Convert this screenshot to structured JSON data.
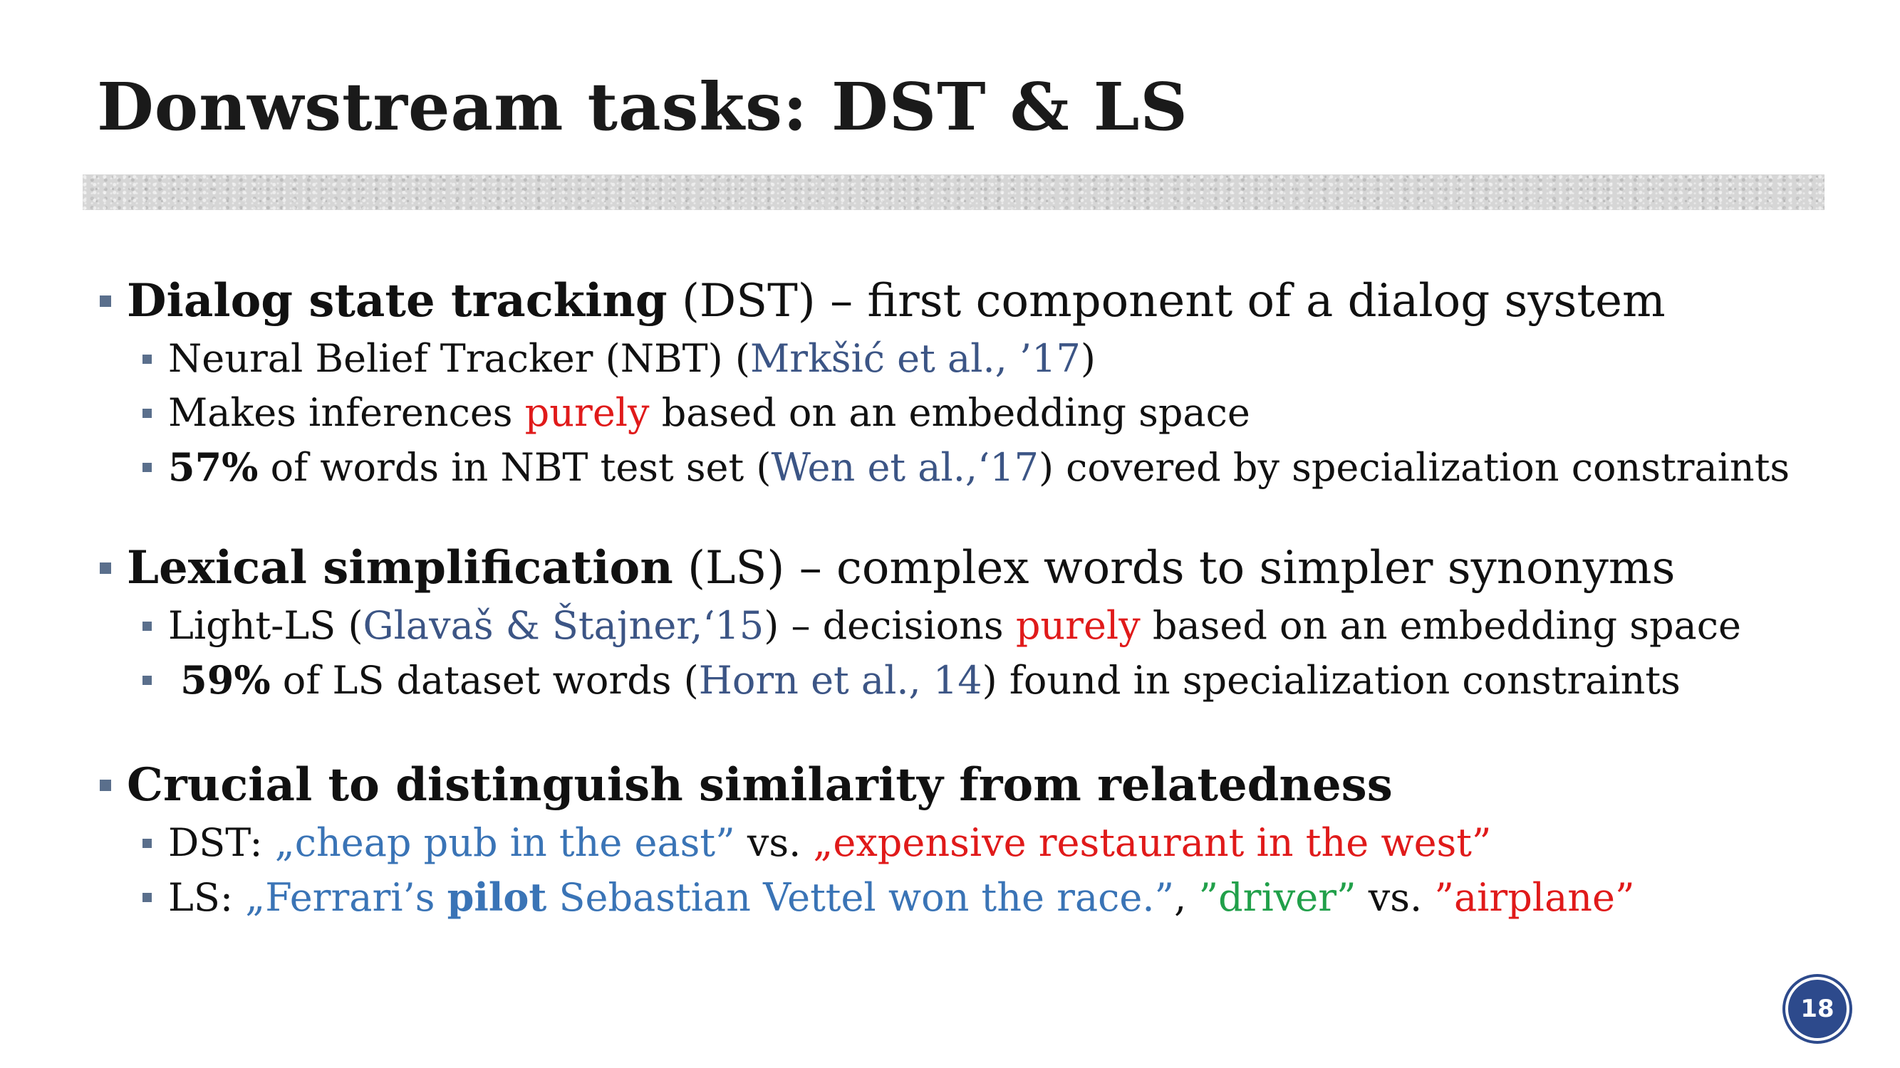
{
  "slide": {
    "title": "Donwstream tasks: DST & LS",
    "page_number": "18"
  },
  "sections": {
    "dst": {
      "heading_bold": "Dialog state tracking",
      "heading_rest": " (DST) – first component of a dialog system",
      "sub1": {
        "pre": "Neural Belief Tracker (NBT) (",
        "cite": "Mrkšić et al., ’17",
        "post": ")"
      },
      "sub2": {
        "pre": "Makes inferences ",
        "highlight": "purely",
        "post": " based on an embedding space"
      },
      "sub3": {
        "bold": "57%",
        "pre": " of words in NBT test set (",
        "cite": "Wen et al.,‘17",
        "post": ") covered by specialization constraints"
      }
    },
    "ls": {
      "heading_bold": "Lexical simplification",
      "heading_rest": " (LS) – complex words to simpler synonyms",
      "sub1": {
        "pre": "Light-LS (",
        "cite": "Glavaš & Štajner,‘15",
        "mid": ") – decisions ",
        "highlight": "purely",
        "post": " based on an embedding space"
      },
      "sub2": {
        "bold": "59%",
        "pre": " of LS dataset words (",
        "cite": "Horn et al., 14",
        "post": ") found in specialization constraints"
      }
    },
    "crucial": {
      "heading_bold": "Crucial to distinguish similarity from relatedness",
      "sub1": {
        "pre": "DST: ",
        "example_a": "„cheap pub in the east”",
        "vs": " vs. ",
        "example_b": "„expensive restaurant in the west”"
      },
      "sub2": {
        "pre": "LS: ",
        "quote_start": "„Ferrari’s ",
        "quote_bold": "pilot",
        "quote_end": " Sebastian Vettel won the race.”",
        "comma": ", ",
        "word_a": "”driver”",
        "vs": " vs. ",
        "word_b": "”airplane”"
      }
    }
  },
  "colors": {
    "citation": "#3c5585",
    "highlight_red": "#e01a1a",
    "example_blue": "#3a74b6",
    "example_green": "#21a04a",
    "bullet": "#5a6f8c",
    "badge": "#2d4a8c"
  }
}
